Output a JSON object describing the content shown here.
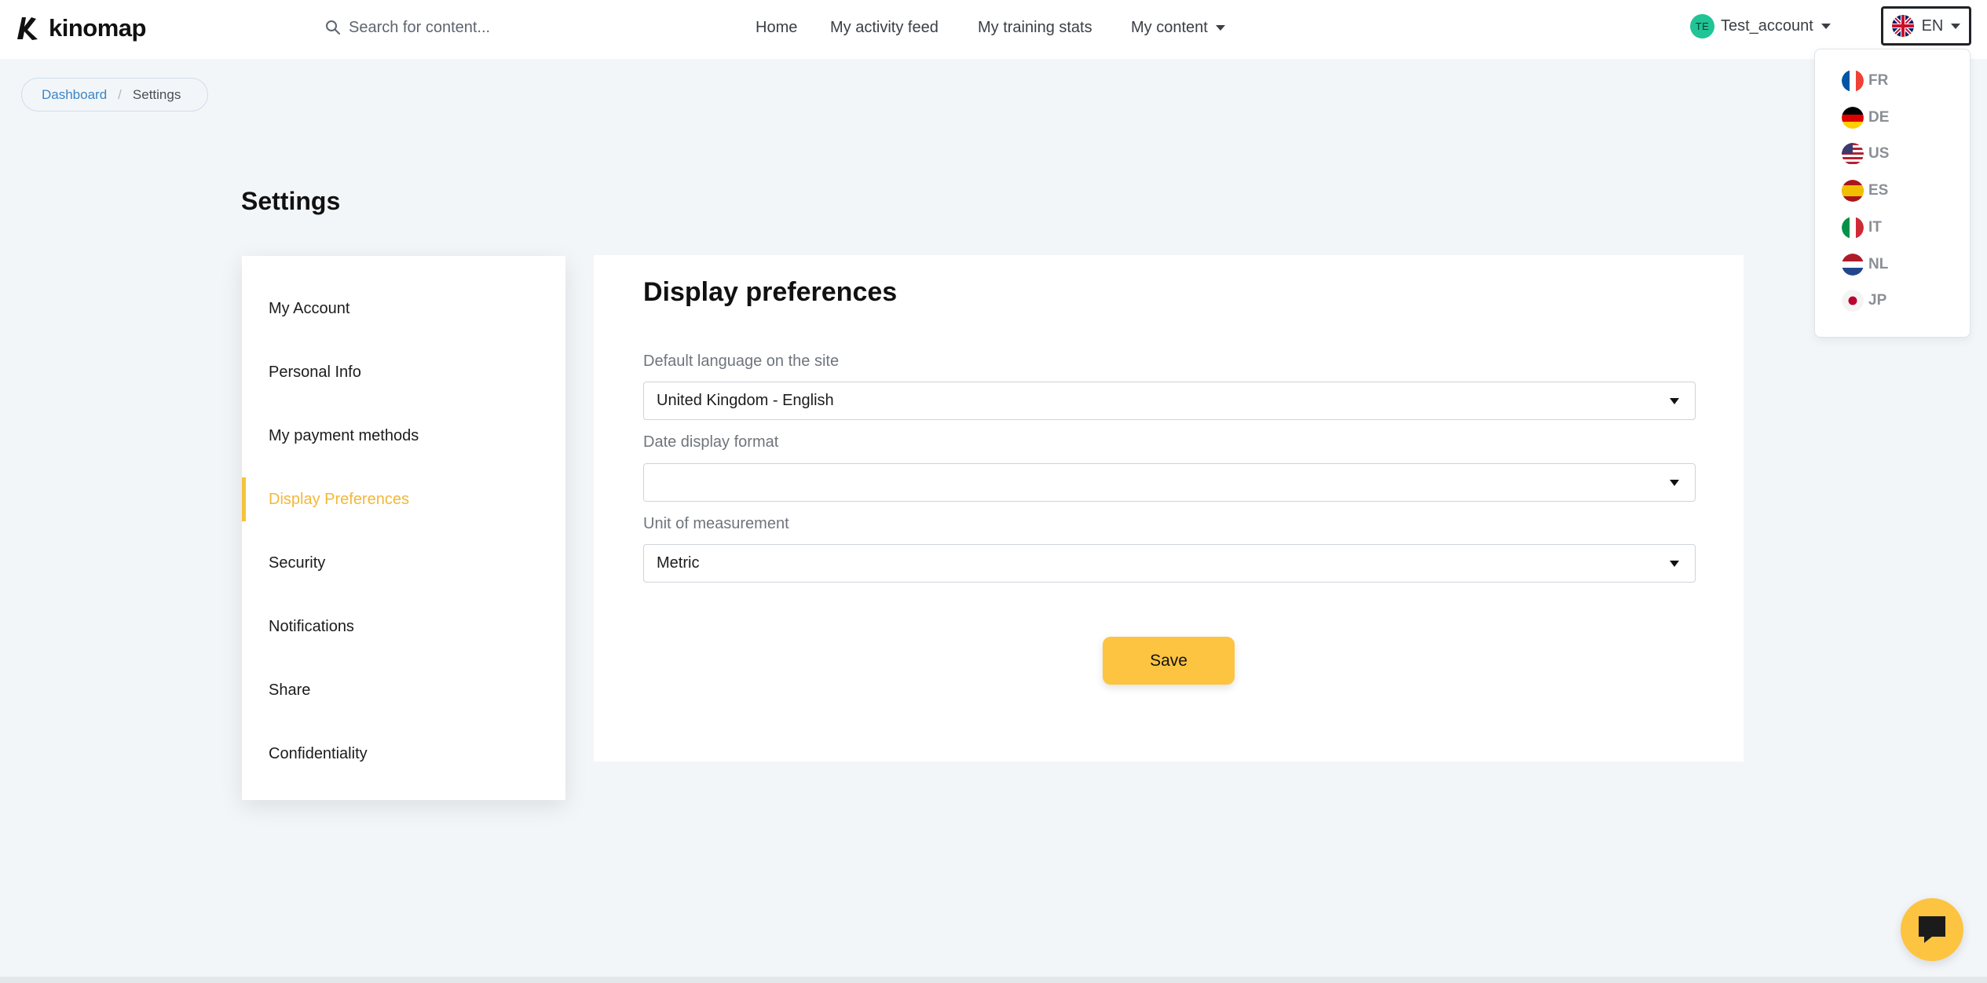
{
  "header": {
    "logo_text": "kinomap",
    "search_placeholder": "Search for content...",
    "nav": {
      "home": "Home",
      "activity_feed": "My activity feed",
      "training_stats": "My training stats",
      "my_content": "My content"
    },
    "account": {
      "initials": "TE",
      "name": "Test_account"
    },
    "language": {
      "current": "EN"
    }
  },
  "language_menu": {
    "items": [
      {
        "code": "FR"
      },
      {
        "code": "DE"
      },
      {
        "code": "US"
      },
      {
        "code": "ES"
      },
      {
        "code": "IT"
      },
      {
        "code": "NL"
      },
      {
        "code": "JP"
      }
    ]
  },
  "breadcrumb": {
    "dashboard": "Dashboard",
    "current": "Settings"
  },
  "page": {
    "title": "Settings"
  },
  "sidebar": {
    "items": [
      {
        "label": "My Account"
      },
      {
        "label": "Personal Info"
      },
      {
        "label": "My payment methods"
      },
      {
        "label": "Display Preferences",
        "active": true
      },
      {
        "label": "Security"
      },
      {
        "label": "Notifications"
      },
      {
        "label": "Share"
      },
      {
        "label": "Confidentiality"
      }
    ]
  },
  "panel": {
    "title": "Display preferences",
    "language": {
      "label": "Default language on the site",
      "value": "United Kingdom - English"
    },
    "date_format": {
      "label": "Date display format",
      "value": ""
    },
    "unit": {
      "label": "Unit of measurement",
      "value": "Metric"
    },
    "save_label": "Save"
  },
  "colors": {
    "accent": "#fcc440",
    "active_text": "#f3b73a",
    "link": "#3a86c8",
    "avatar": "#20c497"
  },
  "icons": {
    "logo": "kinomap-logo-icon",
    "search": "search-icon",
    "chat": "chat-icon"
  }
}
